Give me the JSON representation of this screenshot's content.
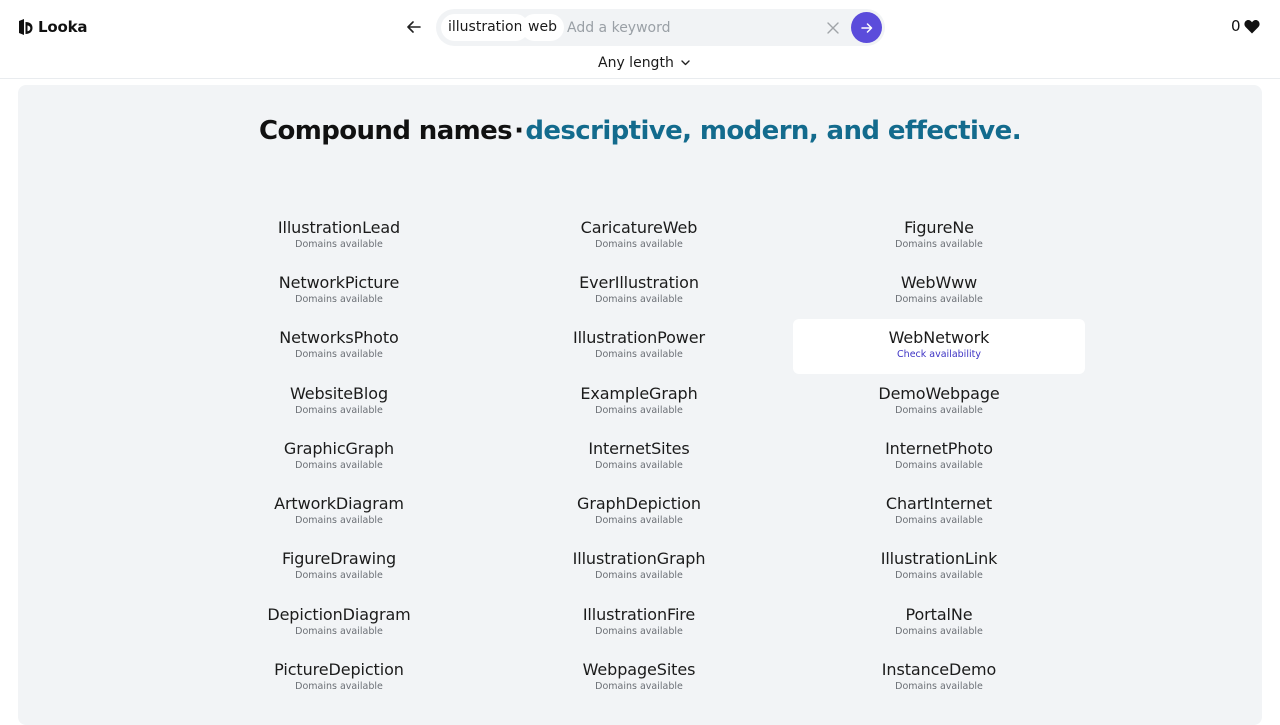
{
  "header": {
    "brand": "Looka",
    "search": {
      "chips": [
        "illustration",
        "web"
      ],
      "placeholder": "Add a keyword",
      "value": ""
    },
    "favorites_count": "0",
    "length_filter": "Any length"
  },
  "colors": {
    "accent": "#136b8d",
    "primary_button": "#5b4cdb",
    "panel_bg": "#f2f4f6"
  },
  "hero": {
    "title_dark": "Compound names",
    "separator": "·",
    "title_accent": "descriptive, modern, and effective."
  },
  "names": [
    {
      "name": "IllustrationLead",
      "status": "Domains available"
    },
    {
      "name": "CaricatureWeb",
      "status": "Domains available"
    },
    {
      "name": "FigureNe",
      "status": "Domains available"
    },
    {
      "name": "NetworkPicture",
      "status": "Domains available"
    },
    {
      "name": "EverIllustration",
      "status": "Domains available"
    },
    {
      "name": "WebWww",
      "status": "Domains available"
    },
    {
      "name": "NetworksPhoto",
      "status": "Domains available"
    },
    {
      "name": "IllustrationPower",
      "status": "Domains available"
    },
    {
      "name": "WebNetwork",
      "status": "Check availability"
    },
    {
      "name": "WebsiteBlog",
      "status": "Domains available"
    },
    {
      "name": "ExampleGraph",
      "status": "Domains available"
    },
    {
      "name": "DemoWebpage",
      "status": "Domains available"
    },
    {
      "name": "GraphicGraph",
      "status": "Domains available"
    },
    {
      "name": "InternetSites",
      "status": "Domains available"
    },
    {
      "name": "InternetPhoto",
      "status": "Domains available"
    },
    {
      "name": "ArtworkDiagram",
      "status": "Domains available"
    },
    {
      "name": "GraphDepiction",
      "status": "Domains available"
    },
    {
      "name": "ChartInternet",
      "status": "Domains available"
    },
    {
      "name": "FigureDrawing",
      "status": "Domains available"
    },
    {
      "name": "IllustrationGraph",
      "status": "Domains available"
    },
    {
      "name": "IllustrationLink",
      "status": "Domains available"
    },
    {
      "name": "DepictionDiagram",
      "status": "Domains available"
    },
    {
      "name": "IllustrationFire",
      "status": "Domains available"
    },
    {
      "name": "PortalNe",
      "status": "Domains available"
    },
    {
      "name": "PictureDepiction",
      "status": "Domains available"
    },
    {
      "name": "WebpageSites",
      "status": "Domains available"
    },
    {
      "name": "InstanceDemo",
      "status": "Domains available"
    }
  ]
}
